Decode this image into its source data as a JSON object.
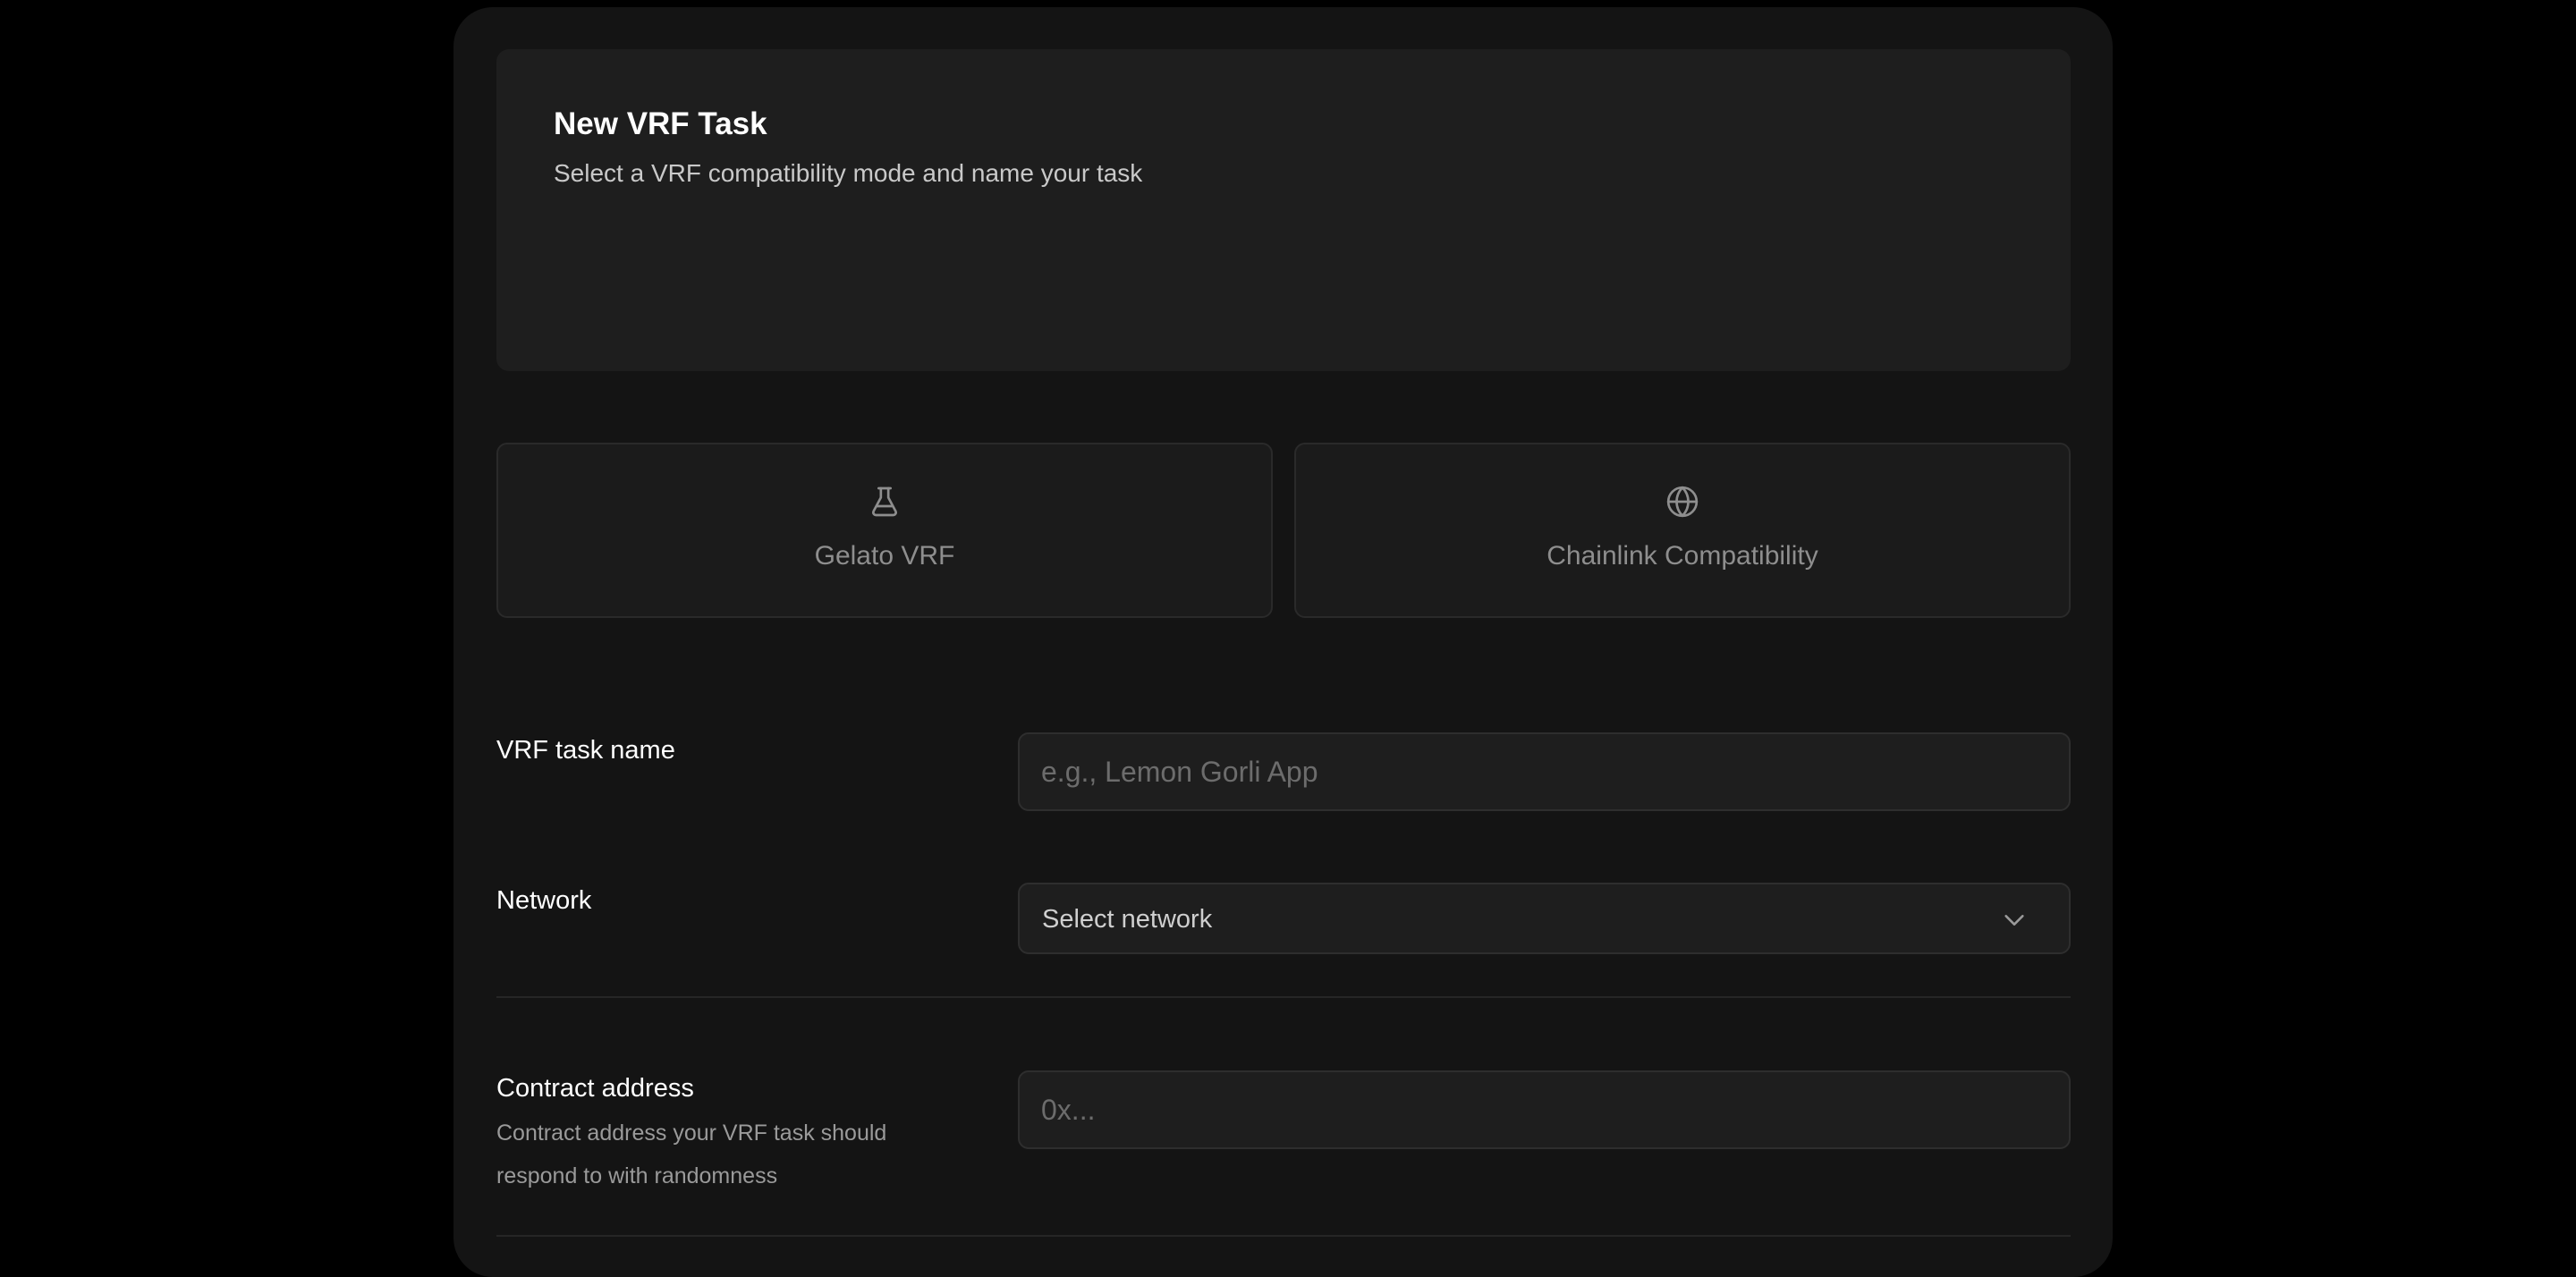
{
  "header": {
    "title": "New VRF Task",
    "subtitle": "Select a VRF compatibility mode and name your task"
  },
  "modes": [
    {
      "label": "Gelato VRF",
      "icon": "flask-icon"
    },
    {
      "label": "Chainlink Compatibility",
      "icon": "globe-icon"
    }
  ],
  "form": {
    "task_name": {
      "label": "VRF task name",
      "value": "",
      "placeholder": "e.g., Lemon Gorli App"
    },
    "network": {
      "label": "Network",
      "selected": "Select network",
      "icon": "chevron-down-icon"
    },
    "contract_address": {
      "label": "Contract address",
      "help": "Contract address your VRF task should respond to with randomness",
      "value": "",
      "placeholder": "0x..."
    }
  },
  "colors": {
    "background": "#000000",
    "panel": "#141414",
    "card": "#1e1e1e",
    "text_primary": "#ffffff",
    "text_muted": "#8e8e8e"
  }
}
